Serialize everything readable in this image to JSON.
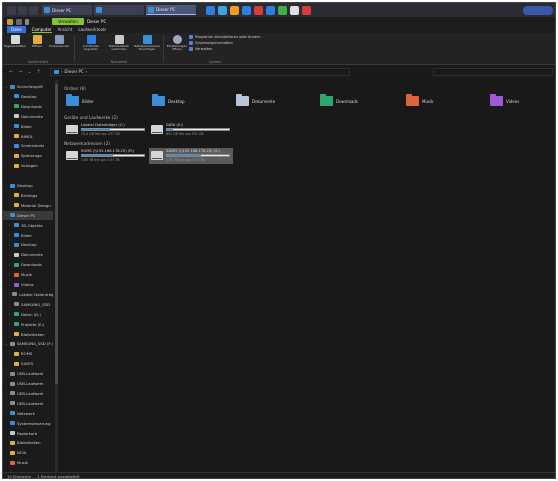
{
  "window_title": "Dieser PC",
  "taskbar": {
    "tasks": [
      {
        "label": "Dieser PC",
        "active": false
      },
      {
        "label": "",
        "active": false
      },
      {
        "label": "Dieser PC",
        "active": true
      }
    ],
    "pinned_colors": [
      "#2e7de0",
      "#3aa2e0",
      "#f0a020",
      "#2e7de0",
      "#d83a3a",
      "#2e7de0",
      "#42b04a",
      "#e0e0e0",
      "#d83a3a"
    ],
    "pill_label": ""
  },
  "titlebar": {
    "context_tab": "Verwalten",
    "title": "Dieser PC"
  },
  "ribbon_tabs": [
    "Datei",
    "Computer",
    "Ansicht",
    "Laufwerktools"
  ],
  "ribbon": {
    "groups": [
      {
        "label": "Speicherort",
        "buttons": [
          "Eigenschaften",
          "Öffnen",
          "Umbenennen"
        ]
      },
      {
        "label": "Netzwerk",
        "buttons": [
          "Auf Medien zugreifen",
          "Netzlaufwerk verbinden",
          "Netzwerkadresse hinzufügen"
        ]
      },
      {
        "label": "System",
        "buttons": [
          "Einstellungen öffnen"
        ],
        "checks": [
          "Programm deinstallieren oder ändern",
          "Systemeigenschaften",
          "Verwalten"
        ]
      }
    ]
  },
  "address": {
    "path": "Dieser PC",
    "sep": "›"
  },
  "nav": [
    {
      "label": "Schnellzugriff",
      "color": "#3a8fd8",
      "chev": "v",
      "indent": 0
    },
    {
      "label": "Desktop",
      "color": "#3a8fd8",
      "chev": "",
      "indent": 1
    },
    {
      "label": "Downloads",
      "color": "#2fa86f",
      "chev": "",
      "indent": 1
    },
    {
      "label": "Dokumente",
      "color": "#c8c8c8",
      "chev": "",
      "indent": 1
    },
    {
      "label": "Bilder",
      "color": "#3a8fd8",
      "chev": "",
      "indent": 1
    },
    {
      "label": "BIMOL",
      "color": "#e0b03a",
      "chev": "",
      "indent": 1
    },
    {
      "label": "Screenshots",
      "color": "#3a8fd8",
      "chev": "",
      "indent": 1
    },
    {
      "label": "Spielzeuge",
      "color": "#e0b03a",
      "chev": "",
      "indent": 1
    },
    {
      "label": "Vorlagen",
      "color": "#e0b03a",
      "chev": "",
      "indent": 1
    },
    {
      "label": "",
      "color": "",
      "chev": "",
      "indent": 0
    },
    {
      "label": "Desktop",
      "color": "#3a8fd8",
      "chev": ">",
      "indent": 0
    },
    {
      "label": "Bindings",
      "color": "#e0b03a",
      "chev": "",
      "indent": 1
    },
    {
      "label": "Material Design",
      "color": "#e0b03a",
      "chev": "",
      "indent": 1
    },
    {
      "label": "Dieser PC",
      "color": "#3a8fd8",
      "chev": "v",
      "indent": 0
    },
    {
      "label": "3D-Objekte",
      "color": "#3a8fd8",
      "chev": ">",
      "indent": 1
    },
    {
      "label": "Bilder",
      "color": "#3a8fd8",
      "chev": ">",
      "indent": 1
    },
    {
      "label": "Desktop",
      "color": "#3a8fd8",
      "chev": ">",
      "indent": 1
    },
    {
      "label": "Dokumente",
      "color": "#c8c8c8",
      "chev": ">",
      "indent": 1
    },
    {
      "label": "Downloads",
      "color": "#2fa86f",
      "chev": ">",
      "indent": 1
    },
    {
      "label": "Musik",
      "color": "#e0643a",
      "chev": ">",
      "indent": 1
    },
    {
      "label": "Videos",
      "color": "#9b5ad8",
      "chev": ">",
      "indent": 1
    },
    {
      "label": "Lokaler Datenträger",
      "color": "#8a8a8a",
      "chev": ">",
      "indent": 1
    },
    {
      "label": "SAMSUNG_SSD",
      "color": "#8a8a8a",
      "chev": ">",
      "indent": 1
    },
    {
      "label": "Daten (D:)",
      "color": "#2fa86f",
      "chev": ">",
      "indent": 1
    },
    {
      "label": "Projekte (E:)",
      "color": "#2fa86f",
      "chev": ">",
      "indent": 1
    },
    {
      "label": "Bibliotheken",
      "color": "#e0b03a",
      "chev": "",
      "indent": 1
    },
    {
      "label": "SAMSUNG_SSD (F:)",
      "color": "#8a8a8a",
      "chev": "v",
      "indent": 0
    },
    {
      "label": "ROMS",
      "color": "#e0b03a",
      "chev": ">",
      "indent": 1
    },
    {
      "label": "SAVES",
      "color": "#e0b03a",
      "chev": "",
      "indent": 1
    },
    {
      "label": "USB-Laufwerk",
      "color": "#8a8a8a",
      "chev": ">",
      "indent": 0
    },
    {
      "label": "USB-Laufwerk",
      "color": "#8a8a8a",
      "chev": ">",
      "indent": 0
    },
    {
      "label": "USB-Laufwerk",
      "color": "#8a8a8a",
      "chev": ">",
      "indent": 0
    },
    {
      "label": "USB-Laufwerk",
      "color": "#8a8a8a",
      "chev": ">",
      "indent": 0
    },
    {
      "label": "Netzwerk",
      "color": "#3a8fd8",
      "chev": ">",
      "indent": 0
    },
    {
      "label": "Systemsteuerung",
      "color": "#3a8fd8",
      "chev": "",
      "indent": 0
    },
    {
      "label": "Papierkorb",
      "color": "#c8c8c8",
      "chev": "",
      "indent": 0
    },
    {
      "label": "Bibliotheken",
      "color": "#e0b03a",
      "chev": "",
      "indent": 0
    },
    {
      "label": "NCIA",
      "color": "#e0b03a",
      "chev": "",
      "indent": 0
    },
    {
      "label": "Musik",
      "color": "#e0643a",
      "chev": "",
      "indent": 0
    }
  ],
  "content": {
    "folders_header": "Ordner (6)",
    "folders": [
      {
        "label": "Bilder",
        "color": "#3a8fd8"
      },
      {
        "label": "Desktop",
        "color": "#3a8fd8"
      },
      {
        "label": "Dokumente",
        "color": "#b8c4d8"
      },
      {
        "label": "Downloads",
        "color": "#2fa86f"
      },
      {
        "label": "Musik",
        "color": "#e0643a"
      },
      {
        "label": "Videos",
        "color": "#9b5ad8"
      }
    ],
    "drives_header": "Geräte und Laufwerke (2)",
    "drives": [
      {
        "name": "Lokaler Datenträger (C:)",
        "used": 0.45,
        "free": "73,4 GB frei von 237 GB",
        "selected": false
      },
      {
        "name": "DATA (D:)",
        "used": 0.1,
        "free": "851 GB frei von 931 GB",
        "selected": false
      }
    ],
    "net_header": "Netzwerkadressen (2)",
    "net": [
      {
        "name": "ROMS (\\\\192.168.178.20) (R:)",
        "used": 0.5,
        "free": "1,65 TB frei von 3,57 TB",
        "selected": false
      },
      {
        "name": "SAVES (\\\\192.168.178.20) (S:)",
        "used": 0.55,
        "free": "1,65 TB frei von 3,57 TB",
        "selected": true
      }
    ]
  },
  "status": {
    "items": "10 Elemente",
    "selected": "1 Element ausgewählt"
  }
}
